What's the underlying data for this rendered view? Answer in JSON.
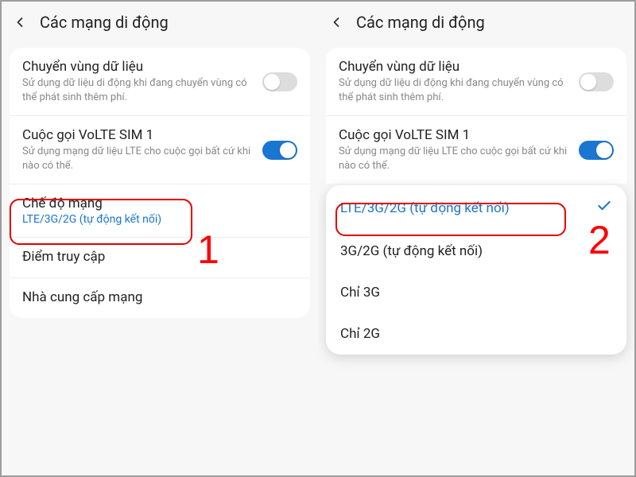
{
  "header": {
    "title": "Các mạng di động"
  },
  "roaming": {
    "title": "Chuyển vùng dữ liệu",
    "sub": "Sử dụng dữ liệu di động khi đang chuyển vùng có thể phát sinh thêm phí."
  },
  "volte": {
    "title": "Cuộc gọi VoLTE SIM 1",
    "sub": "Sử dụng mạng dữ liệu LTE cho cuộc gọi bất cứ khi nào có thể."
  },
  "network_mode": {
    "title": "Chế độ mạng",
    "value": "LTE/3G/2G (tự động kết nối)"
  },
  "apn": {
    "title": "Điểm truy cập"
  },
  "provider": {
    "title": "Nhà cung cấp mạng"
  },
  "dropdown": {
    "opt1": "LTE/3G/2G (tự động kết nối)",
    "opt2": "3G/2G (tự động kết nối)",
    "opt3": "Chỉ 3G",
    "opt4": "Chỉ 2G"
  },
  "steps": {
    "one": "1",
    "two": "2"
  }
}
